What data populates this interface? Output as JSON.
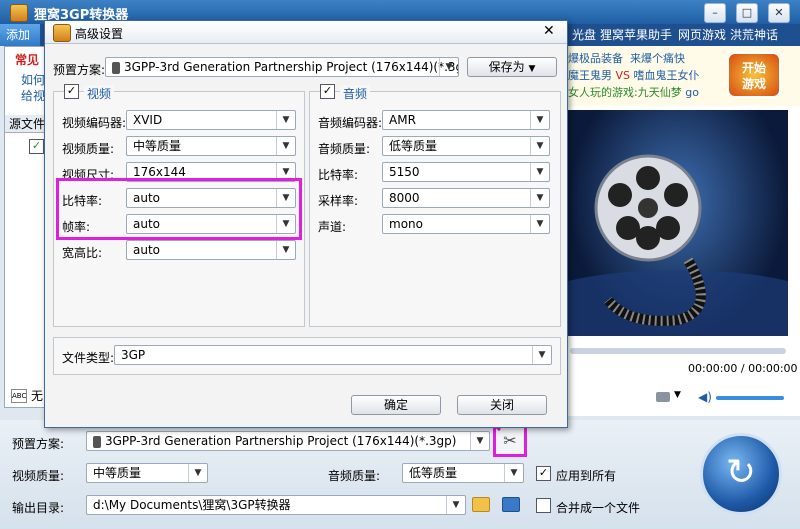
{
  "app": {
    "title": "狸窝3GP转换器",
    "title_icon": "3GP"
  },
  "window_controls": {
    "minimize": "–",
    "maximize": "□",
    "close": "✕"
  },
  "menubar": {
    "add_tab": "添加",
    "items": [
      "光盘",
      "狸窝苹果助手",
      "网页游戏",
      "洪荒神话"
    ]
  },
  "left_panel": {
    "heading": "常见",
    "links": [
      "如何",
      "给视"
    ],
    "source_header": "源文件",
    "bottom_label": "无"
  },
  "ads": {
    "line1": [
      "爆极品装备",
      "来爆个痛快"
    ],
    "line2": [
      "魔王鬼男",
      "VS",
      "嗜血鬼王女仆"
    ],
    "line3": [
      "女人玩的游戏:九天仙梦",
      "go"
    ],
    "start_button": [
      "开始",
      "游戏"
    ]
  },
  "player": {
    "time_current": "00:00:00",
    "time_total": "00:00:00",
    "time_sep": "/"
  },
  "dialog": {
    "title": "高级设置",
    "preset_label": "预置方案:",
    "preset_value": "3GPP-3rd Generation Partnership Project (176x144)(*.3gp)",
    "save_as": "保存为",
    "video": {
      "title": "视频",
      "rows": [
        {
          "label": "视频编码器:",
          "value": "XVID"
        },
        {
          "label": "视频质量:",
          "value": "中等质量"
        },
        {
          "label": "视频尺寸:",
          "value": "176x144"
        },
        {
          "label": "比特率:",
          "value": "auto"
        },
        {
          "label": "帧率:",
          "value": "auto"
        },
        {
          "label": "宽高比:",
          "value": "auto"
        }
      ]
    },
    "audio": {
      "title": "音频",
      "rows": [
        {
          "label": "音频编码器:",
          "value": "AMR"
        },
        {
          "label": "音频质量:",
          "value": "低等质量"
        },
        {
          "label": "比特率:",
          "value": "5150"
        },
        {
          "label": "采样率:",
          "value": "8000"
        },
        {
          "label": "声道:",
          "value": "mono"
        }
      ]
    },
    "file_type_label": "文件类型:",
    "file_type_value": "3GP",
    "ok": "确定",
    "close": "关闭"
  },
  "bottom": {
    "preset_label": "预置方案:",
    "preset_value": "3GPP-3rd Generation Partnership Project (176x144)(*.3gp)",
    "video_quality_label": "视频质量:",
    "video_quality_value": "中等质量",
    "audio_quality_label": "音频质量:",
    "audio_quality_value": "低等质量",
    "apply_all": "应用到所有",
    "output_label": "输出目录:",
    "output_value": "d:\\My Documents\\狸窝\\3GP转换器",
    "merge": "合并成一个文件"
  },
  "colors": {
    "highlight": "#e01ee0",
    "title_blue": "#1f5ea5"
  }
}
